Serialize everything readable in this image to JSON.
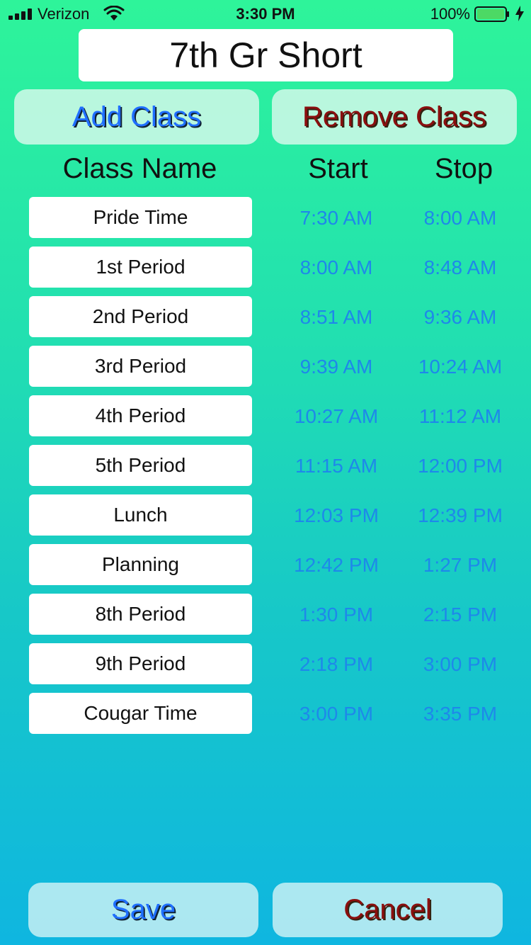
{
  "status_bar": {
    "carrier": "Verizon",
    "time": "3:30 PM",
    "battery_percent": "100%",
    "signal_bars": 4,
    "icons": [
      "signal-icon",
      "wifi-icon",
      "battery-icon",
      "charging-bolt-icon"
    ]
  },
  "schedule_title": "7th Gr Short",
  "buttons": {
    "add_class": "Add Class",
    "remove_class": "Remove Class",
    "save": "Save",
    "cancel": "Cancel"
  },
  "headers": {
    "class_name": "Class Name",
    "start": "Start",
    "stop": "Stop"
  },
  "classes": [
    {
      "name": "Pride Time",
      "start": "7:30 AM",
      "stop": "8:00 AM"
    },
    {
      "name": "1st Period",
      "start": "8:00 AM",
      "stop": "8:48 AM"
    },
    {
      "name": "2nd Period",
      "start": "8:51 AM",
      "stop": "9:36 AM"
    },
    {
      "name": "3rd Period",
      "start": "9:39 AM",
      "stop": "10:24 AM"
    },
    {
      "name": "4th Period",
      "start": "10:27 AM",
      "stop": "11:12 AM"
    },
    {
      "name": "5th Period",
      "start": "11:15 AM",
      "stop": "12:00 PM"
    },
    {
      "name": "Lunch",
      "start": "12:03 PM",
      "stop": "12:39 PM"
    },
    {
      "name": "Planning",
      "start": "12:42 PM",
      "stop": "1:27 PM"
    },
    {
      "name": "8th Period",
      "start": "1:30 PM",
      "stop": "2:15 PM"
    },
    {
      "name": "9th Period",
      "start": "2:18 PM",
      "stop": "3:00 PM"
    },
    {
      "name": "Cougar Time",
      "start": "3:00 PM",
      "stop": "3:35 PM"
    }
  ],
  "colors": {
    "add_text": "#1f6fff",
    "remove_text": "#8a0f0f",
    "time_text": "#1e88ea",
    "battery_fill": "#4cd964"
  }
}
